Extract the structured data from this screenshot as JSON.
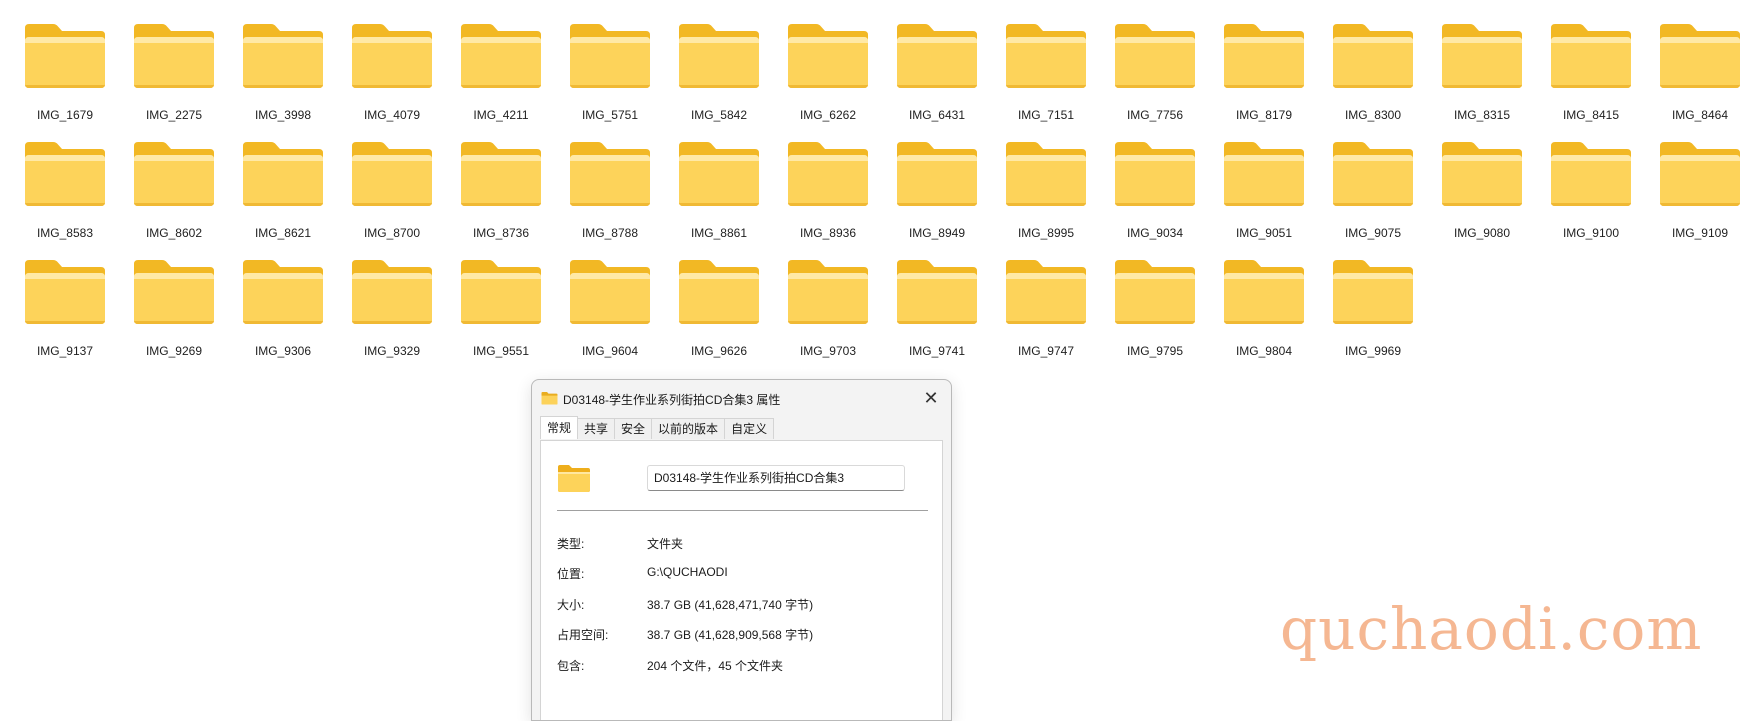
{
  "folders": [
    "IMG_1679",
    "IMG_2275",
    "IMG_3998",
    "IMG_4079",
    "IMG_4211",
    "IMG_5751",
    "IMG_5842",
    "IMG_6262",
    "IMG_6431",
    "IMG_7151",
    "IMG_7756",
    "IMG_8179",
    "IMG_8300",
    "IMG_8315",
    "IMG_8415",
    "IMG_8464",
    "IMG_8583",
    "IMG_8602",
    "IMG_8621",
    "IMG_8700",
    "IMG_8736",
    "IMG_8788",
    "IMG_8861",
    "IMG_8936",
    "IMG_8949",
    "IMG_8995",
    "IMG_9034",
    "IMG_9051",
    "IMG_9075",
    "IMG_9080",
    "IMG_9100",
    "IMG_9109",
    "IMG_9137",
    "IMG_9269",
    "IMG_9306",
    "IMG_9329",
    "IMG_9551",
    "IMG_9604",
    "IMG_9626",
    "IMG_9703",
    "IMG_9741",
    "IMG_9747",
    "IMG_9795",
    "IMG_9804",
    "IMG_9969"
  ],
  "folder_icon": "folder-icon",
  "colors": {
    "folder_back": "#f2b824",
    "folder_front": "#fdd35a",
    "folder_highlight": "#ffe9a6",
    "watermark": "#f5b792"
  },
  "dialog": {
    "title": "D03148-学生作业系列街拍CD合集3 属性",
    "close_glyph": "✕",
    "tabs": [
      "常规",
      "共享",
      "安全",
      "以前的版本",
      "自定义"
    ],
    "active_tab": "常规",
    "name_value": "D03148-学生作业系列街拍CD合集3",
    "properties": {
      "type_label": "类型:",
      "type_value": "文件夹",
      "location_label": "位置:",
      "location_value": "G:\\QUCHAODI",
      "size_label": "大小:",
      "size_value": "38.7 GB (41,628,471,740 字节)",
      "size_on_disk_label": "占用空间:",
      "size_on_disk_value": "38.7 GB (41,628,909,568 字节)",
      "contains_label": "包含:",
      "contains_value": "204 个文件，45 个文件夹"
    }
  },
  "watermark": "quchaodi.com"
}
